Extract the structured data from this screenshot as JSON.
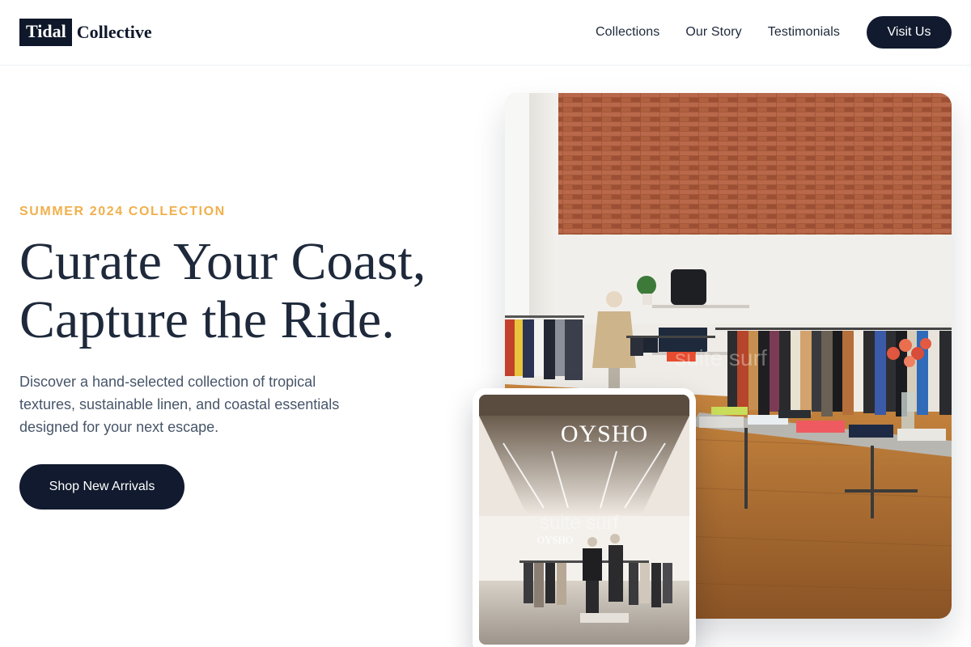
{
  "header": {
    "logo_mark": "Tidal",
    "logo_text": "Collective",
    "nav": [
      "Collections",
      "Our Story",
      "Testimonials"
    ],
    "cta": "Visit Us"
  },
  "hero": {
    "eyebrow": "SUMMER 2024 COLLECTION",
    "headline_line1": "Curate Your Coast,",
    "headline_line2": "Capture the Ride.",
    "subcopy": "Discover a hand-selected collection of tropical textures, sustainable linen, and coastal essentials designed for your next escape.",
    "cta": "Shop New Arrivals"
  },
  "images": {
    "main_watermark": "suite surf",
    "inset_sign": "OYSHO",
    "inset_sign_small": "OYSHO",
    "inset_watermark": "suite surf"
  },
  "colors": {
    "accent": "#f0b04c",
    "dark": "#111a2e",
    "text": "#1e293b",
    "muted": "#475569"
  }
}
